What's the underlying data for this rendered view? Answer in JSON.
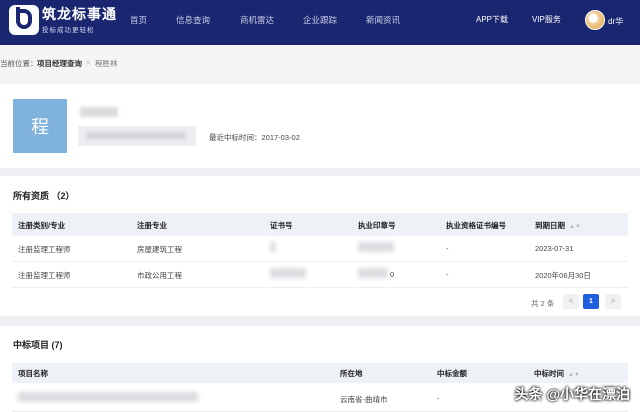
{
  "brand": {
    "name": "筑龙标事通",
    "slogan": "投标成功更轻松"
  },
  "nav": {
    "items": [
      "首页",
      "信息查询",
      "商机雷达",
      "企业跟踪",
      "新闻资讯"
    ],
    "app_download": "APP下载",
    "vip": "VIP服务",
    "user_name": "dr华"
  },
  "breadcrumb": {
    "label": "当前位置：",
    "level1": "项目经理查询",
    "separator": ">",
    "level2": "程胜林"
  },
  "profile": {
    "avatar_char": "程",
    "last_win_label": "最近中标时间：",
    "last_win_date": "2017-03-02"
  },
  "qualifications": {
    "title": "所有资质 （2）",
    "columns": [
      "注册类别/专业",
      "注册专业",
      "证书号",
      "执业印章号",
      "执业资格证书编号",
      "到期日期"
    ],
    "rows": [
      {
        "category": "注册监理工程师",
        "specialty": "房屋建筑工程",
        "cert_no_suffix": "",
        "seal_no_suffix": "",
        "qual_no": "-",
        "expiry": "2023-07-31"
      },
      {
        "category": "注册监理工程师",
        "specialty": "市政公用工程",
        "cert_no_suffix": "",
        "seal_no_suffix": "0",
        "qual_no": "-",
        "expiry": "2020年06月30日"
      }
    ],
    "pager": {
      "total": "共 2 条",
      "prev": "<",
      "current": "1",
      "next": ">"
    }
  },
  "projects": {
    "title": "中标项目 (7)",
    "columns": [
      "项目名称",
      "所在地",
      "中标金额",
      "中标时间"
    ],
    "rows": [
      {
        "location": "云南省-曲靖市",
        "amount": "-"
      }
    ]
  },
  "watermark": "头条 @小华在漂泊"
}
